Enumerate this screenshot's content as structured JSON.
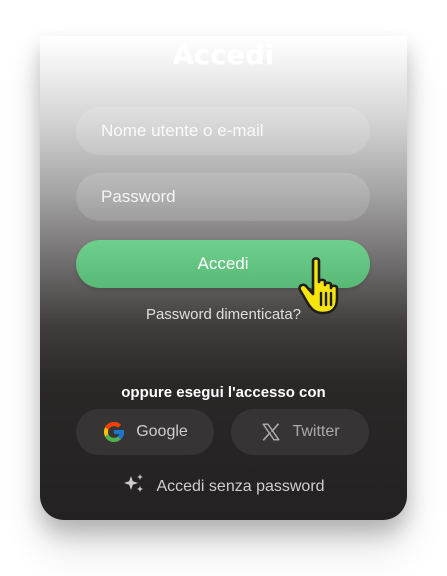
{
  "login": {
    "title": "Accedi",
    "username_placeholder": "Nome utente o e-mail",
    "password_placeholder": "Password",
    "submit_label": "Accedi",
    "forgot_link": "Password dimenticata?",
    "alt_heading": "oppure esegui l'accesso con",
    "social": [
      {
        "label": "Google",
        "icon": "google-icon"
      },
      {
        "label": "Twitter",
        "icon": "x-icon"
      }
    ],
    "passwordless_label": "Accedi senza password",
    "passwordless_icon": "sparkle-icon"
  },
  "colors": {
    "accent_green": "#5fc180",
    "cursor_yellow": "#f6e40a"
  }
}
